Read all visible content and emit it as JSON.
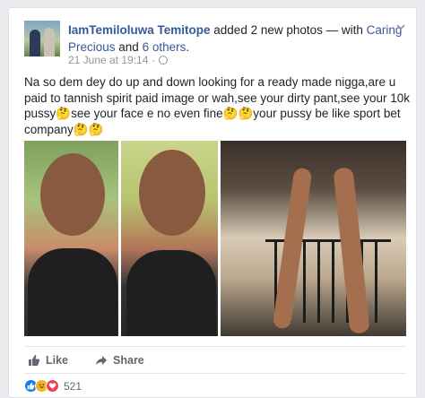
{
  "post": {
    "author": "IamTemiloluwa Temitope",
    "action_text": " added 2 new photos — with ",
    "tagged": "Caring Precious",
    "and_text": " and ",
    "others": "6 others",
    "end_punct": ".",
    "timestamp": "21 June at 19:14",
    "dot": "·",
    "body": "Na so dem dey do up and down looking for a ready made nigga,are u paid to tannish spirit paid image or wah,see your dirty pant,see your 10k pussy🤔see your face e no even fine🤔🤔your pussy be like sport bet company🤔🤔"
  },
  "actions": {
    "like_label": "Like",
    "share_label": "Share"
  },
  "reactions": {
    "count": "521"
  },
  "icons": {
    "globe": "globe-icon",
    "chevron": "chevron-down-icon",
    "like": "thumbs-up-icon",
    "share": "share-arrow-icon"
  },
  "colors": {
    "link": "#365899",
    "meta": "#90949c",
    "like_reaction": "#1877f2",
    "haha_reaction": "#f7b125",
    "love_reaction": "#f33e58"
  }
}
